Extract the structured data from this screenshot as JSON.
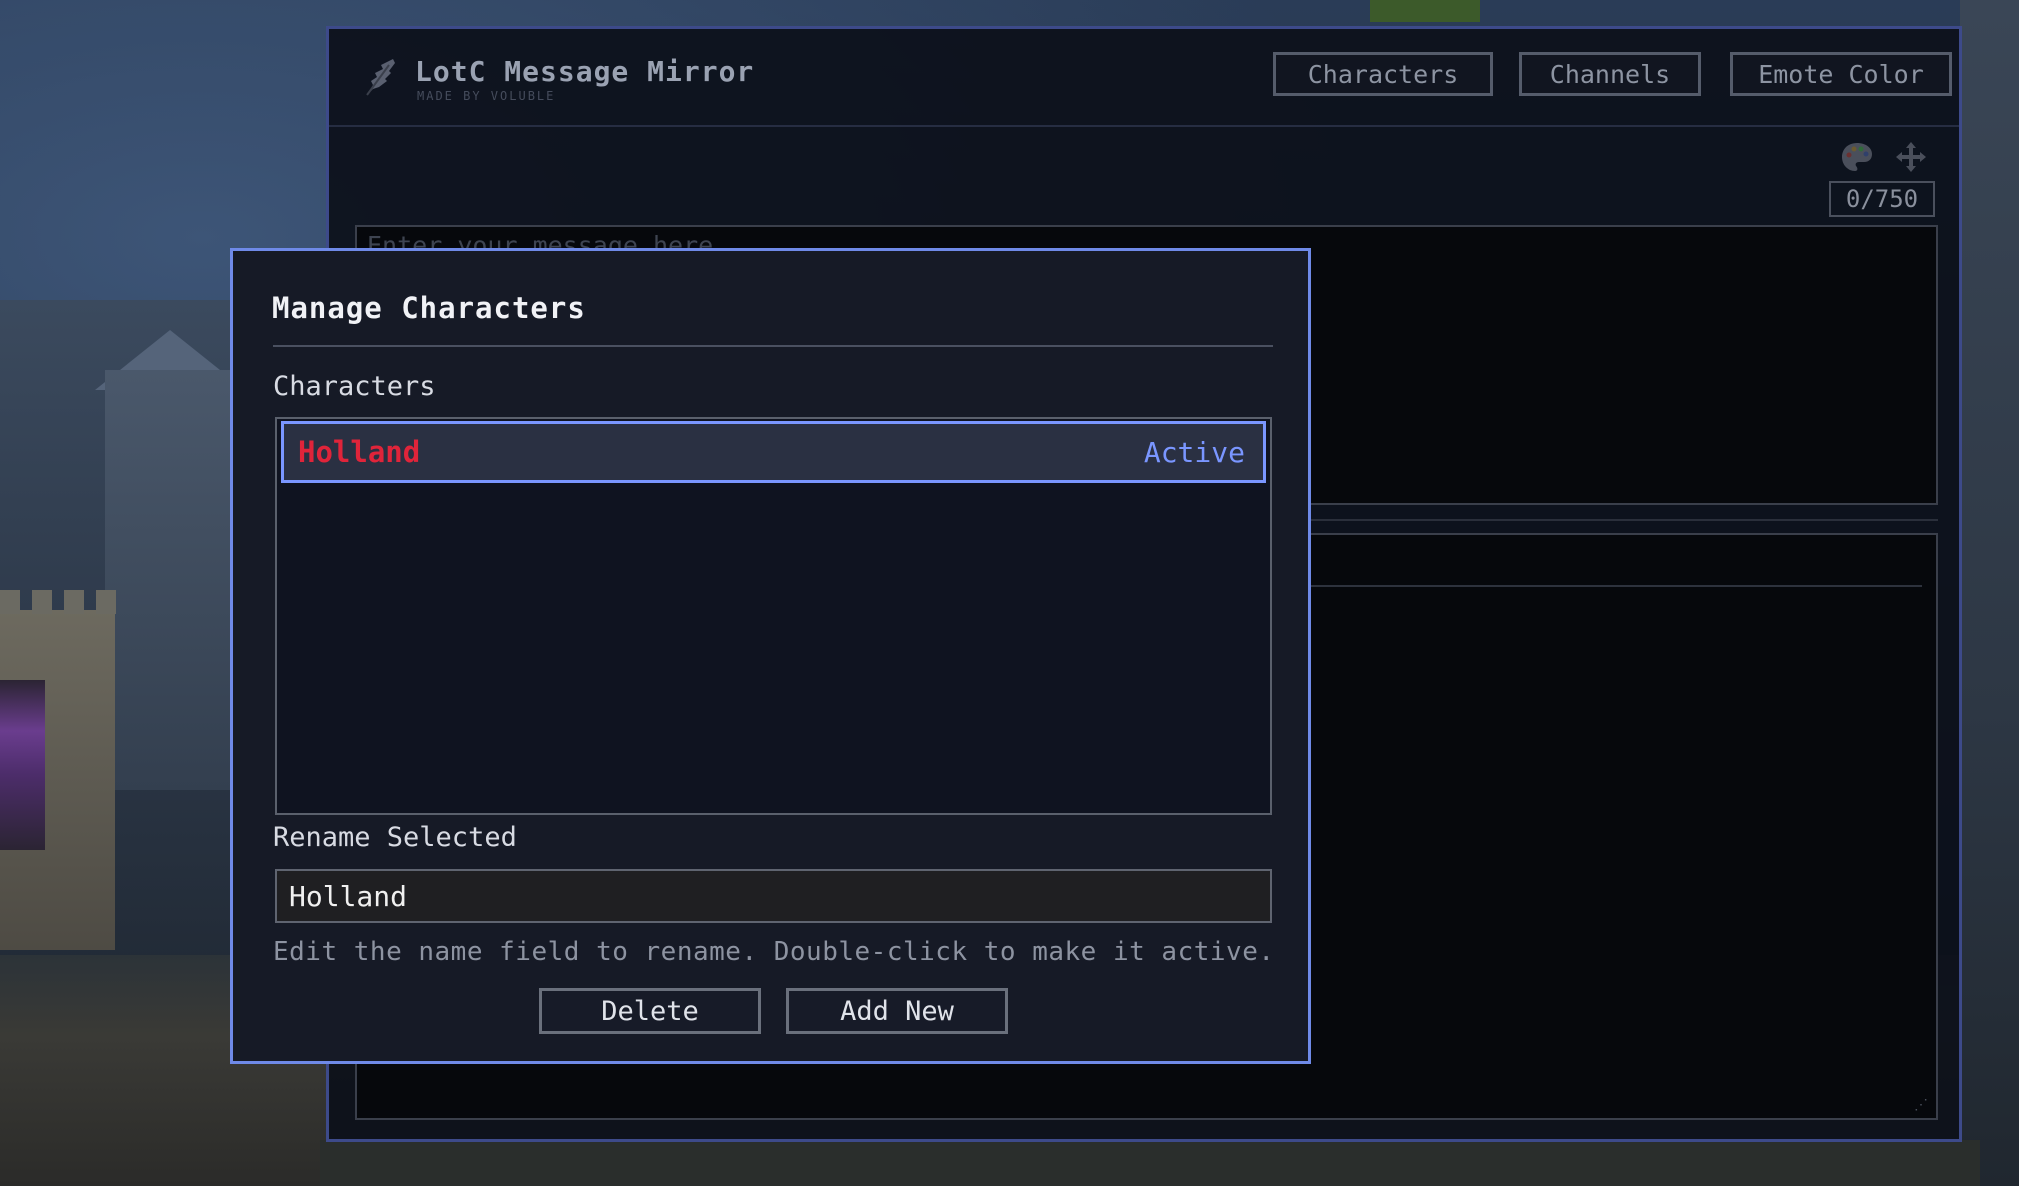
{
  "app": {
    "title": "LotC Message Mirror",
    "subtitle": "MADE BY VOLUBLE"
  },
  "header_nav": [
    {
      "label": "Characters"
    },
    {
      "label": "Channels"
    },
    {
      "label": "Emote Color"
    }
  ],
  "editor": {
    "placeholder": "Enter your message here",
    "char_count": "0/750",
    "tools": [
      {
        "icon": "palette-icon"
      },
      {
        "icon": "move-icon"
      }
    ]
  },
  "modal": {
    "title": "Manage Characters",
    "list_label": "Characters",
    "characters": [
      {
        "name": "Holland",
        "status": "Active",
        "name_color": "#e0243a",
        "selected": true
      }
    ],
    "rename_label": "Rename Selected",
    "rename_value": "Holland",
    "hint": "Edit the name field to rename. Double-click to make it active.",
    "delete_label": "Delete",
    "add_label": "Add New"
  },
  "colors": {
    "accent": "#6f8ae8",
    "selection_border": "#7a96ff",
    "active_name": "#e0243a",
    "window_border": "#3d4a8a"
  }
}
